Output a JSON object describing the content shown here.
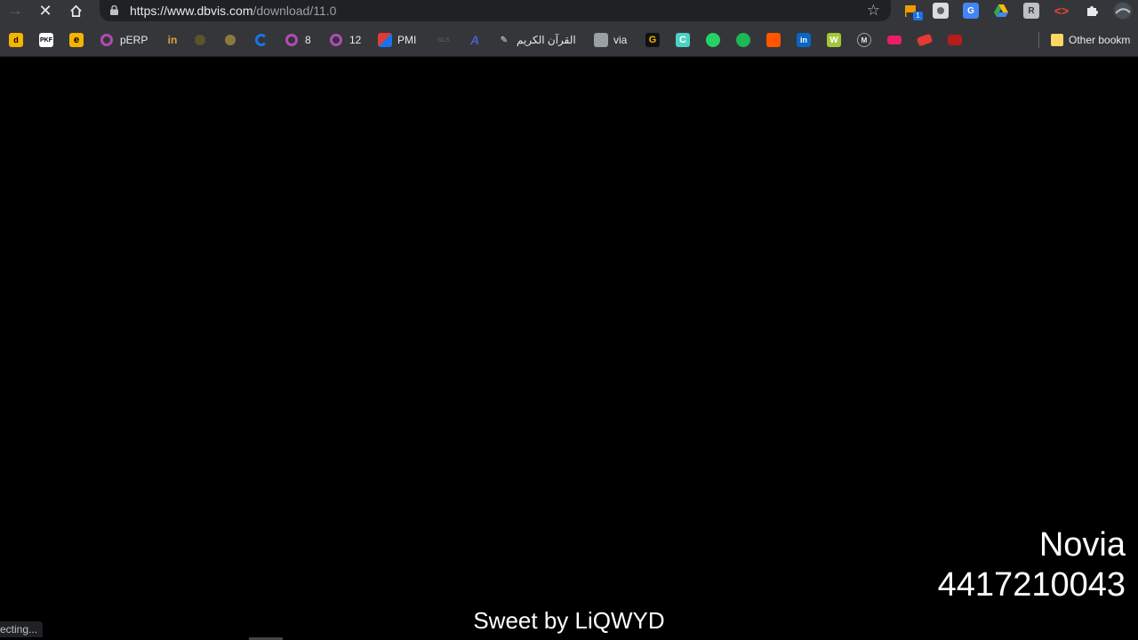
{
  "browser": {
    "url_host": "https://www.dbvis.com",
    "url_path": "/download/11.0",
    "icons": {
      "forward": "forward-arrow-icon",
      "stop": "stop-loading-icon",
      "home": "home-icon",
      "lock": "lock-icon",
      "star": "bookmark-star-icon"
    },
    "extensions": [
      "flag-extension-icon",
      "extension-icon",
      "google-translate-icon",
      "google-drive-icon",
      "extension-icon",
      "code-extension-icon",
      "puzzle-icon",
      "profile-avatar-icon"
    ],
    "extension_badge": "1"
  },
  "bookmarks": {
    "items": [
      {
        "label": "",
        "icon": "d",
        "color": "#f4b400"
      },
      {
        "label": "",
        "icon": "PKF",
        "color": "#ffffff"
      },
      {
        "label": "",
        "icon": "e",
        "color": "#f4b400"
      },
      {
        "label": "pERP",
        "icon": "ring",
        "color": "#b14bb5"
      },
      {
        "label": "",
        "icon": "in",
        "color": "#e8a13c"
      },
      {
        "label": "",
        "icon": "crest",
        "color": "#8a7a3c"
      },
      {
        "label": "",
        "icon": "crest",
        "color": "#8a7a3c"
      },
      {
        "label": "",
        "icon": "circle",
        "color": "#1a73e8"
      },
      {
        "label": "8",
        "icon": "ring",
        "color": "#b14bb5"
      },
      {
        "label": "12",
        "icon": "ring",
        "color": "#b14bb5"
      },
      {
        "label": "PMI",
        "icon": "pmi",
        "color": "#1a73e8"
      },
      {
        "label": "",
        "icon": "SLS",
        "color": "#555555"
      },
      {
        "label": "",
        "icon": "A",
        "color": "#4f5bd5"
      },
      {
        "label": "القرآن الكريم",
        "icon": "quran",
        "color": "#9aa0a6"
      },
      {
        "label": "via",
        "icon": "via",
        "color": "#9aa0a6"
      },
      {
        "label": "",
        "icon": "G",
        "color": "#f4b400"
      },
      {
        "label": "",
        "icon": "C",
        "color": "#4dd0c4"
      },
      {
        "label": "",
        "icon": "wa",
        "color": "#25d366"
      },
      {
        "label": "",
        "icon": "sp",
        "color": "#1db954"
      },
      {
        "label": "",
        "icon": "sc",
        "color": "#ff5500"
      },
      {
        "label": "",
        "icon": "in",
        "color": "#0a66c2"
      },
      {
        "label": "",
        "icon": "W",
        "color": "#a4c639"
      },
      {
        "label": "",
        "icon": "M",
        "color": "#9aa0a6"
      },
      {
        "label": "",
        "icon": "bm",
        "color": "#e91e63"
      },
      {
        "label": "",
        "icon": "bm",
        "color": "#e53935"
      },
      {
        "label": "",
        "icon": "bm",
        "color": "#b71c1c"
      }
    ],
    "other_label": "Other bookm"
  },
  "page": {
    "overlay_name": "Novia",
    "overlay_number": "4417210043",
    "subtitle": "Sweet by LiQWYD",
    "status_text": "ecting..."
  }
}
